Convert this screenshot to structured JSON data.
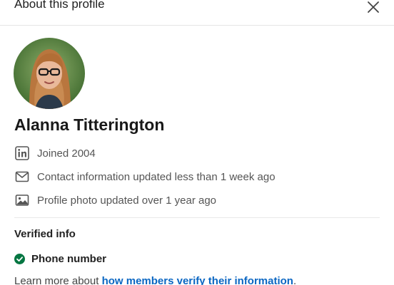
{
  "header": {
    "title": "About this profile",
    "close_icon": "close-icon"
  },
  "profile": {
    "name": "Alanna Titterington",
    "avatar_icon": "profile-photo"
  },
  "details": [
    {
      "icon": "linkedin-icon",
      "text": "Joined 2004"
    },
    {
      "icon": "envelope-icon",
      "text": "Contact information updated less than 1 week ago"
    },
    {
      "icon": "image-icon",
      "text": "Profile photo updated over 1 year ago"
    }
  ],
  "verified": {
    "title": "Verified info",
    "items": [
      {
        "icon": "check-circle-icon",
        "label": "Phone number"
      }
    ],
    "learn_prefix": "Learn more about ",
    "learn_link": "how members verify their information",
    "learn_suffix": "."
  },
  "colors": {
    "link": "#0a66c2",
    "verified_green": "#057642",
    "text_secondary": "#555555"
  }
}
